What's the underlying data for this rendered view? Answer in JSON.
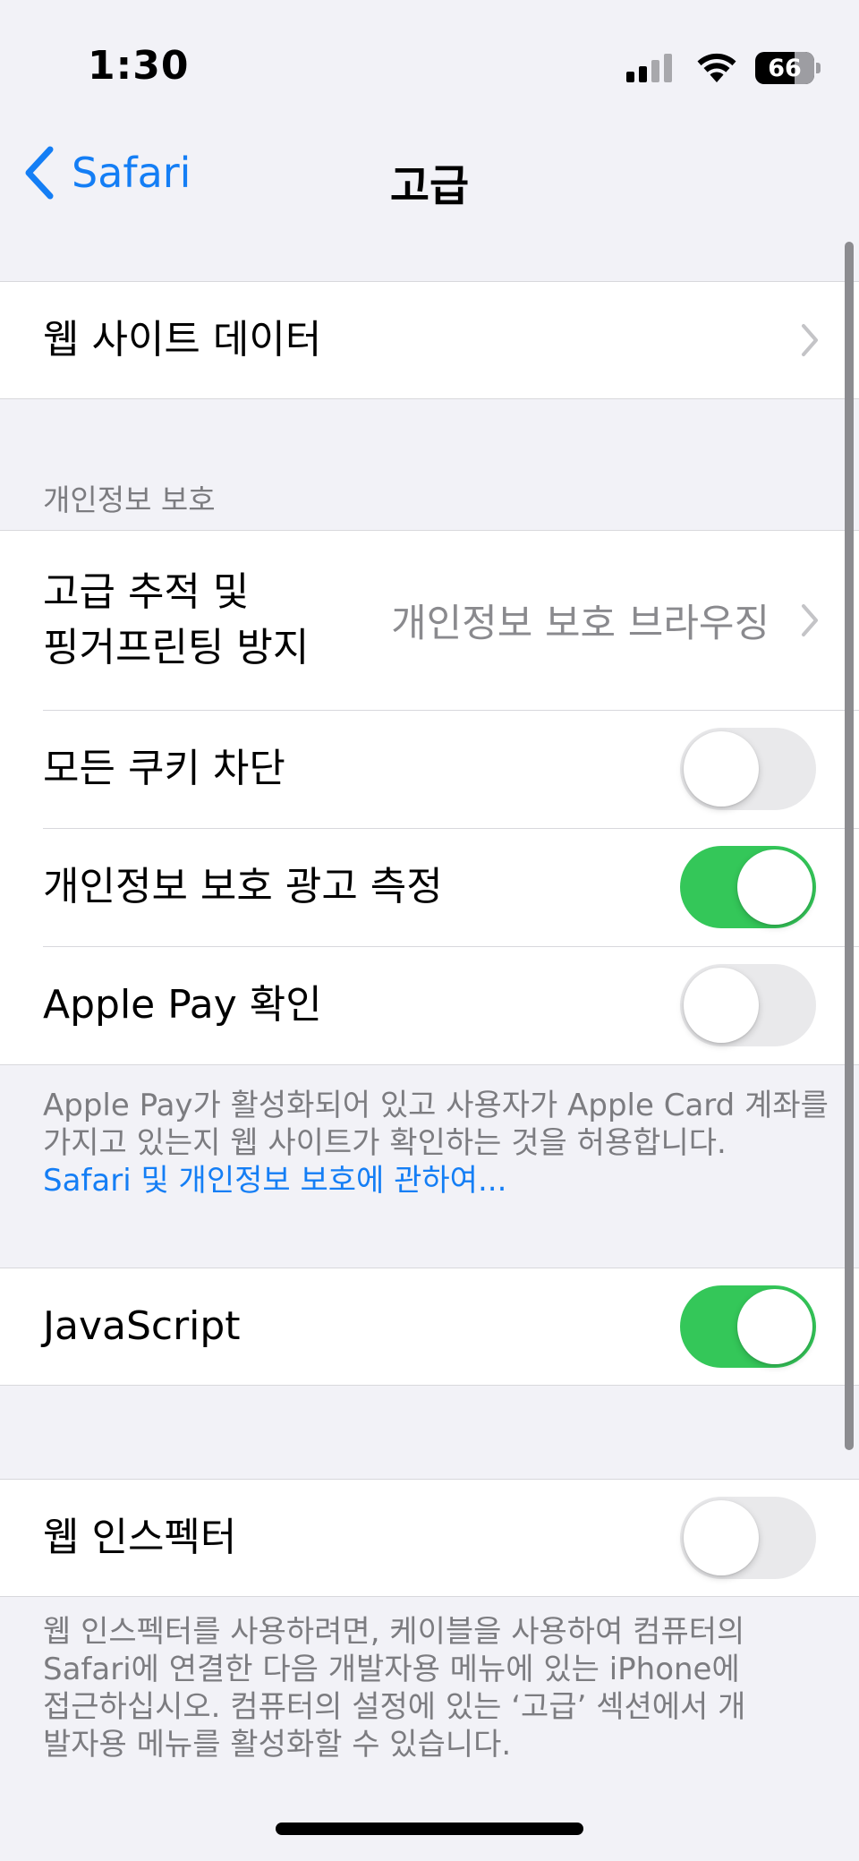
{
  "status_bar": {
    "time": "1:30",
    "battery_level": "66",
    "signal_bars_active": 2,
    "signal_bars_total": 4
  },
  "nav": {
    "back_label": "Safari",
    "title": "고급"
  },
  "website_data": {
    "label": "웹 사이트 데이터"
  },
  "privacy": {
    "header": "개인정보 보호",
    "tracking": {
      "label_line1": "고급 추적 및",
      "label_line2": "핑거프린팅 방지",
      "value": "개인정보 보호 브라우징"
    },
    "block_cookies": {
      "label": "모든 쿠키 차단",
      "enabled": false
    },
    "ad_measurement": {
      "label": "개인정보 보호 광고 측정",
      "enabled": true
    },
    "apple_pay_check": {
      "label": "Apple Pay 확인",
      "enabled": false
    },
    "footer_text": "Apple Pay가 활성화되어 있고 사용자가 Apple Card 계좌를 가지고 있는지 웹 사이트가 확인하는 것을 허용합니다.",
    "footer_link": "Safari 및 개인정보 보호에 관하여..."
  },
  "javascript": {
    "label": "JavaScript",
    "enabled": true
  },
  "web_inspector": {
    "label": "웹 인스펙터",
    "enabled": false,
    "footer_text": "웹 인스펙터를 사용하려면, 케이블을 사용하여 컴퓨터의 Safari에 연결한 다음 개발자용 메뉴에 있는 iPhone에 접근하십시오. 컴퓨터의 설정에 있는 ‘고급’ 섹션에서 개발자용 메뉴를 활성화할 수 있습니다."
  },
  "colors": {
    "accent": "#147ef5",
    "toggle_on": "#34c759",
    "toggle_off": "#e9e9eb",
    "background": "#f2f2f7"
  },
  "icons": {
    "back": "chevron-left-icon",
    "disclosure": "chevron-right-icon",
    "signal": "cellular-signal-icon",
    "wifi": "wifi-icon",
    "battery": "battery-icon"
  }
}
